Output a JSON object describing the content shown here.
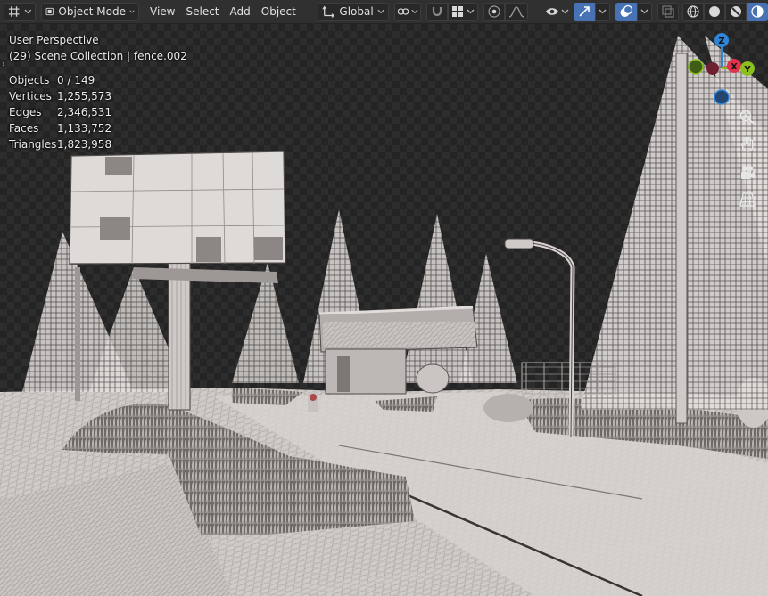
{
  "header": {
    "mode": {
      "label": "Object Mode"
    },
    "menus": [
      {
        "key": "view",
        "label": "View"
      },
      {
        "key": "select",
        "label": "Select"
      },
      {
        "key": "add",
        "label": "Add"
      },
      {
        "key": "object",
        "label": "Object"
      }
    ],
    "orientation": {
      "label": "Global"
    }
  },
  "viewport": {
    "perspective": "User Perspective",
    "collection": "(29) Scene Collection | fence.002",
    "stats": [
      {
        "label": "Objects",
        "value": "0 / 149"
      },
      {
        "label": "Vertices",
        "value": "1,255,573"
      },
      {
        "label": "Edges",
        "value": "2,346,531"
      },
      {
        "label": "Faces",
        "value": "1,133,752"
      },
      {
        "label": "Triangles",
        "value": "1,823,958"
      }
    ]
  },
  "gizmo": {
    "z_label": "Z",
    "x_label": "X",
    "y_label": "Y"
  },
  "colors": {
    "accent": "#4772b3",
    "axis_x": "#e0334b",
    "axis_y": "#8bbf20",
    "axis_z": "#2f86d8"
  }
}
